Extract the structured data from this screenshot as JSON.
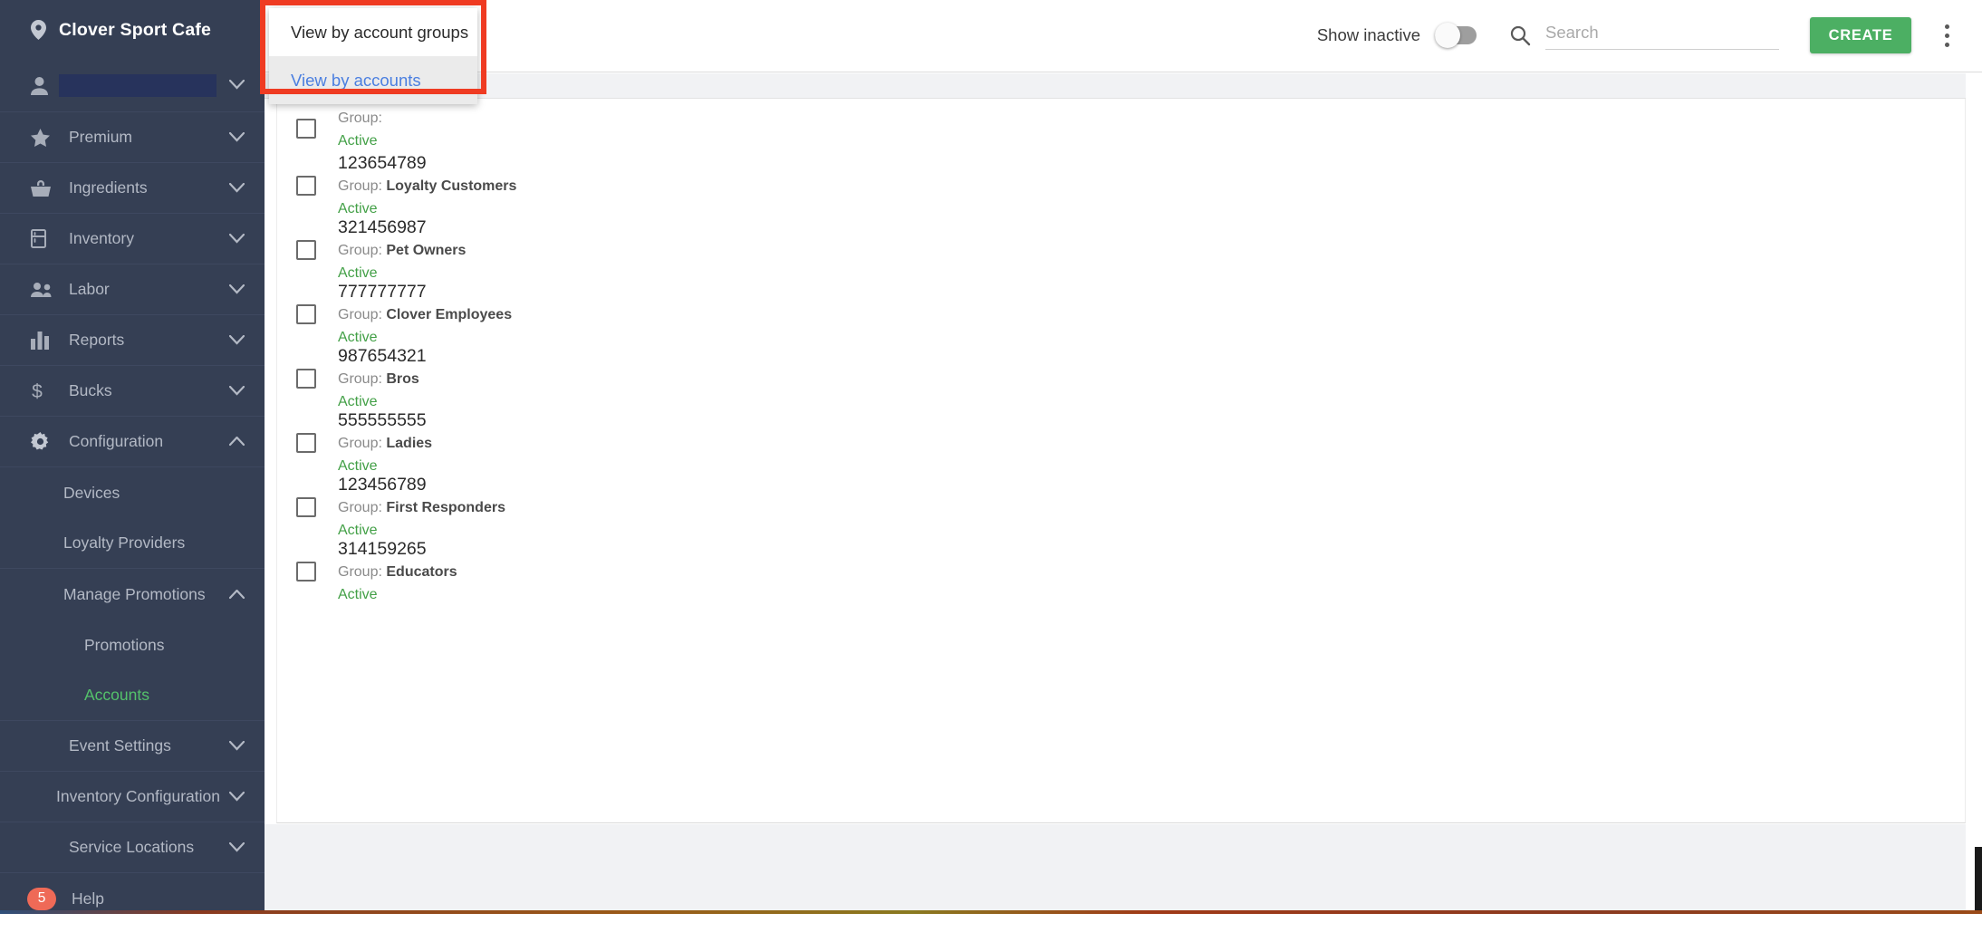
{
  "brand": {
    "name": "Clover Sport Cafe",
    "icon": "location-pin-icon"
  },
  "user": {
    "value": "",
    "icon": "person-icon",
    "chevron": "chevron-down-icon"
  },
  "sidebar": {
    "items": [
      {
        "label": "Premium",
        "icon": "star-icon",
        "chevron": "chevron-down-icon"
      },
      {
        "label": "Ingredients",
        "icon": "basket-icon",
        "chevron": "chevron-down-icon"
      },
      {
        "label": "Inventory",
        "icon": "fridge-icon",
        "chevron": "chevron-down-icon"
      },
      {
        "label": "Labor",
        "icon": "people-icon",
        "chevron": "chevron-down-icon"
      },
      {
        "label": "Reports",
        "icon": "bar-chart-icon",
        "chevron": "chevron-down-icon"
      },
      {
        "label": "Bucks",
        "icon": "dollar-icon",
        "chevron": "chevron-down-icon"
      },
      {
        "label": "Configuration",
        "icon": "gear-icon",
        "chevron": "chevron-up-icon"
      }
    ],
    "config_children": [
      {
        "label": "Devices"
      },
      {
        "label": "Loyalty Providers"
      },
      {
        "label": "Manage Promotions",
        "chevron": "chevron-up-icon"
      }
    ],
    "promotions_children": [
      {
        "label": "Promotions",
        "active": false
      },
      {
        "label": "Accounts",
        "active": true
      }
    ],
    "tail_items": [
      {
        "label": "Event Settings",
        "chevron": "chevron-down-icon"
      },
      {
        "label": "Inventory Configuration",
        "chevron": "chevron-down-icon"
      },
      {
        "label": "Service Locations",
        "chevron": "chevron-down-icon"
      }
    ],
    "help": {
      "label": "Help",
      "badge": "5",
      "badge_color": "#ef6a57"
    },
    "active_color": "#54c26b"
  },
  "toolbar": {
    "show_inactive_label": "Show inactive",
    "show_inactive_on": false,
    "search_icon": "search-icon",
    "search_placeholder": "Search",
    "search_value": "",
    "create_label": "CREATE",
    "create_color": "#4caf63",
    "overflow_icon": "kebab-menu-icon"
  },
  "dropdown": {
    "items": [
      {
        "label": "View by account groups",
        "selected": false
      },
      {
        "label": "View by accounts",
        "selected": true
      }
    ],
    "selected_color": "#4b7fe0",
    "highlight_color": "#ef3b22"
  },
  "list": {
    "group_prefix": "Group:",
    "rows": [
      {
        "account": "",
        "group": "",
        "status": "Active",
        "partial": true
      },
      {
        "account": "123654789",
        "group": "Loyalty Customers",
        "status": "Active"
      },
      {
        "account": "321456987",
        "group": "Pet Owners",
        "status": "Active"
      },
      {
        "account": "777777777",
        "group": "Clover Employees",
        "status": "Active"
      },
      {
        "account": "987654321",
        "group": "Bros",
        "status": "Active"
      },
      {
        "account": "555555555",
        "group": "Ladies",
        "status": "Active"
      },
      {
        "account": "123456789",
        "group": "First Responders",
        "status": "Active"
      },
      {
        "account": "314159265",
        "group": "Educators",
        "status": "Active"
      }
    ],
    "status_color": "#43a047"
  }
}
